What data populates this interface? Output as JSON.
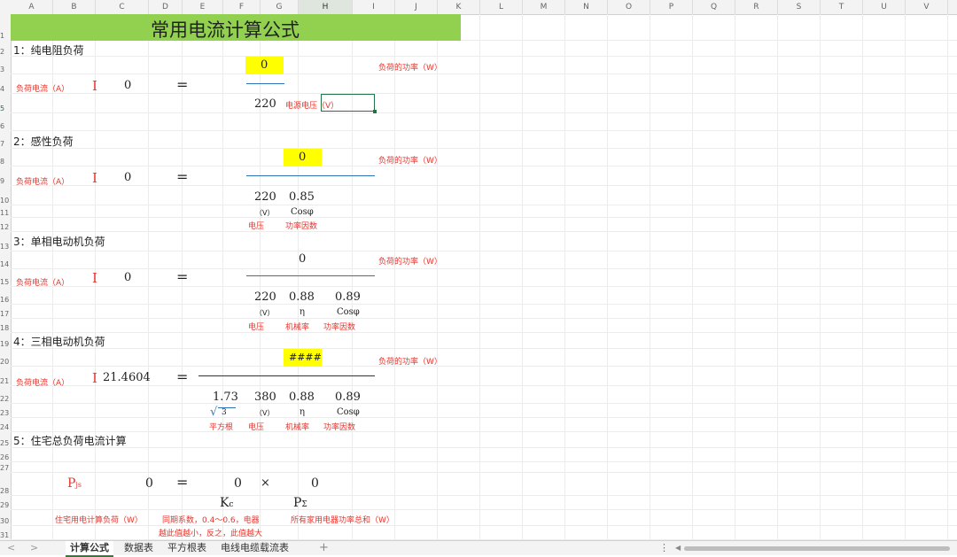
{
  "columns": [
    "A",
    "B",
    "C",
    "D",
    "E",
    "F",
    "G",
    "H",
    "I",
    "J",
    "K",
    "L",
    "M",
    "N",
    "O",
    "P",
    "Q",
    "R",
    "S",
    "T",
    "U",
    "V"
  ],
  "rows": [
    "1",
    "2",
    "3",
    "4",
    "5",
    "6",
    "7",
    "8",
    "9",
    "10",
    "11",
    "12",
    "13",
    "14",
    "15",
    "16",
    "17",
    "18",
    "19",
    "20",
    "21",
    "22",
    "23",
    "24",
    "25",
    "26",
    "27",
    "28",
    "29",
    "30",
    "31"
  ],
  "title": "常用电流计算公式",
  "colors": {
    "title_bg": "#92d050",
    "highlight": "#ffff00",
    "label_red": "#e5372f",
    "fraction_blue": "#2e73b6",
    "sheet_tab_accent": "#2e7d32"
  },
  "sections": {
    "s1": {
      "heading": "1：纯电阻负荷",
      "power_value": "0",
      "power_label": "负荷的功率（W）",
      "current_label": "负荷电流（A）",
      "symbol_i": "I",
      "result": "0",
      "equals": "=",
      "voltage": "220",
      "voltage_label": "电源电压（V）"
    },
    "s2": {
      "heading": "2：感性负荷",
      "power_value": "0",
      "power_label": "负荷的功率（W）",
      "current_label": "负荷电流（A）",
      "symbol_i": "I",
      "result": "0",
      "equals": "=",
      "voltage": "220",
      "pf": "0.85",
      "unit_v": "（V）",
      "cos_phi": "Cosφ",
      "voltage_label": "电压",
      "pf_label": "功率因数"
    },
    "s3": {
      "heading": "3：单相电动机负荷",
      "power_value": "0",
      "power_label": "负荷的功率（W）",
      "current_label": "负荷电流（A）",
      "symbol_i": "I",
      "result": "0",
      "equals": "=",
      "voltage": "220",
      "eff": "0.88",
      "pf": "0.89",
      "unit_v": "（V）",
      "eta": "η",
      "cos_phi": "Cosφ",
      "voltage_label": "电压",
      "eff_label": "机械率",
      "pf_label": "功率因数"
    },
    "s4": {
      "heading": "4：三相电动机负荷",
      "power_value": "####",
      "power_label": "负荷的功率（W）",
      "current_label": "负荷电流（A）",
      "symbol_i": "I",
      "result": "21.4604",
      "equals": "=",
      "sqrt_value": "1.73",
      "voltage": "380",
      "eff": "0.88",
      "pf": "0.89",
      "sqrt_symbol": "√",
      "sqrt_arg": "3",
      "unit_v": "（V）",
      "eta": "η",
      "cos_phi": "Cosφ",
      "sqrt_label": "平方根",
      "voltage_label": "电压",
      "eff_label": "机械率",
      "pf_label": "功率因数"
    },
    "s5": {
      "heading": "5：住宅总负荷电流计算",
      "pjs_main": "P",
      "pjs_sub": "js",
      "pjs_value": "0",
      "equals": "=",
      "kc_value": "0",
      "times": "×",
      "psum_value": "0",
      "kc_main": "K",
      "kc_sub": "c",
      "psum_main": "P",
      "psum_sub": "Σ",
      "pjs_label": "住宅用电计算负荷（W）",
      "kc_label_1": "同期系数，0.4～0.6，电器",
      "kc_label_2": "越此值越小，反之，此值越大",
      "psum_label": "所有家用电器功率总和（W）"
    }
  },
  "sheet_tabs": {
    "prev": "<",
    "next": ">",
    "tabs": [
      "计算公式",
      "数据表",
      "平方根表",
      "电线电缆载流表"
    ],
    "add": "+",
    "more": "⋮",
    "scroll_left": "◀"
  }
}
